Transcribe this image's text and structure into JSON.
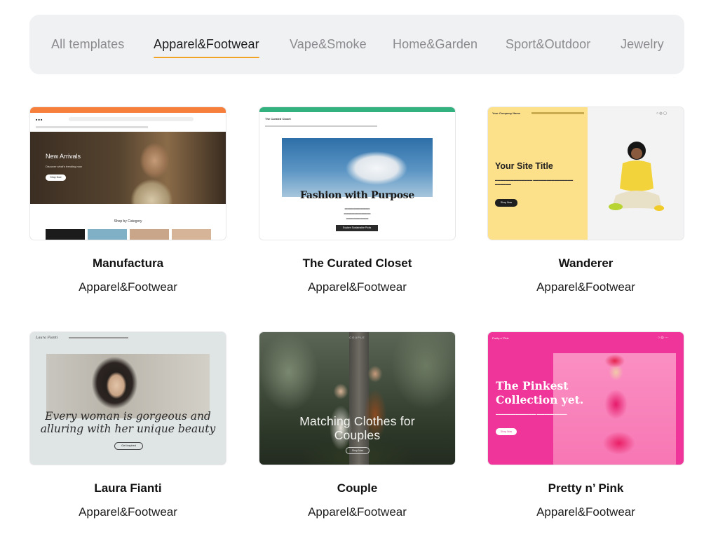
{
  "tabs": [
    {
      "label": "All templates",
      "active": false
    },
    {
      "label": "Apparel&Footwear",
      "active": true
    },
    {
      "label": "Vape&Smoke",
      "active": false
    },
    {
      "label": "Home&Garden",
      "active": false
    },
    {
      "label": "Sport&Outdoor",
      "active": false
    },
    {
      "label": "Jewelry",
      "active": false
    }
  ],
  "accent_color": "#f2a324",
  "templates": [
    {
      "name": "Manufactura",
      "category": "Apparel&Footwear",
      "preview": {
        "hero_title": "New Arrivals",
        "hero_subtitle": "Discover what's trending now",
        "hero_button": "Shop Now",
        "section_title": "Shop by Category",
        "accent": "#f57f3b"
      }
    },
    {
      "name": "The Curated Closet",
      "category": "Apparel&Footwear",
      "preview": {
        "site_name": "The Curated Closet",
        "headline": "Fashion with Purpose",
        "button": "Explore Sustainable Picks",
        "accent": "#33b27f"
      }
    },
    {
      "name": "Wanderer",
      "category": "Apparel&Footwear",
      "preview": {
        "company": "Your Company Name",
        "title": "Your Site Title",
        "button": "Shop Now",
        "accent": "#fde08a"
      }
    },
    {
      "name": "Laura Fianti",
      "category": "Apparel&Footwear",
      "preview": {
        "brand": "Laura Fianti",
        "quote_line1": "Every woman is gorgeous and",
        "quote_line2": "alluring with her unique beauty",
        "button": "Get Inspired"
      }
    },
    {
      "name": "Couple",
      "category": "Apparel&Footwear",
      "preview": {
        "brand": "COUPLE",
        "headline_line1": "Matching Clothes for",
        "headline_line2": "Couples",
        "button": "Shop Now"
      }
    },
    {
      "name": "Pretty n’ Pink",
      "category": "Apparel&Footwear",
      "preview": {
        "brand": "Pretty n' Pink",
        "title_line1": "The Pinkest",
        "title_line2": "Collection yet.",
        "button": "Shop Now",
        "accent": "#f0359a"
      }
    }
  ]
}
